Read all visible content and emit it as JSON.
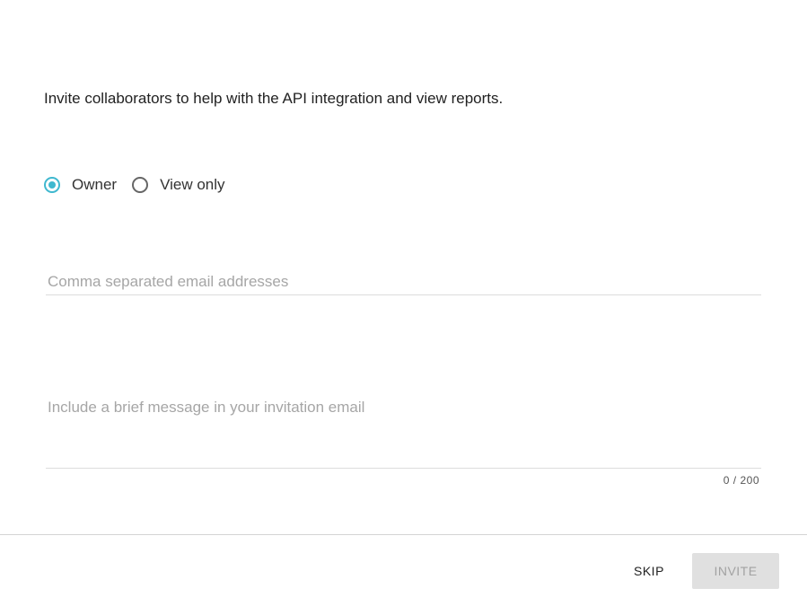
{
  "intro_text": "Invite collaborators to help with the API integration and view reports.",
  "role_options": [
    {
      "label": "Owner",
      "checked": true
    },
    {
      "label": "View only",
      "checked": false
    }
  ],
  "email_field": {
    "value": "",
    "placeholder": "Comma separated email addresses"
  },
  "message_field": {
    "value": "",
    "placeholder": "Include a brief message in your invitation email",
    "counter": "0 / 200"
  },
  "actions": {
    "skip_label": "SKIP",
    "invite_label": "INVITE"
  },
  "colors": {
    "accent": "#3fb8cf",
    "disabled_button_bg": "#e0e0e0",
    "disabled_button_text": "#a2a2a2"
  }
}
